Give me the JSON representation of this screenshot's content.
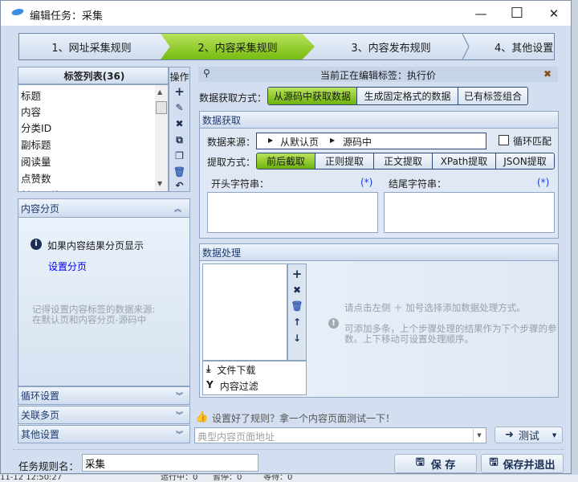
{
  "window": {
    "title": "编辑任务：采集",
    "minimize": "—",
    "maximize": "☐",
    "close": "✕"
  },
  "steps": [
    "1、网址采集规则",
    "2、内容采集规则",
    "3、内容发布规则",
    "4、其他设置"
  ],
  "active_step": 1,
  "tag_list": {
    "header": "标签列表(36)",
    "ops_label": "操作",
    "items": [
      "标题",
      "内容",
      "分类ID",
      "副标题",
      "阅读量",
      "点赞数",
      "封面图片"
    ]
  },
  "content_paging": {
    "title": "内容分页",
    "info": "如果内容结果分页显示",
    "link": "设置分页",
    "note1": "记得设置内容标签的数据来源:",
    "note2": "在默认页和内容分页-源码中"
  },
  "accordions": [
    "循环设置",
    "关联多页",
    "其他设置"
  ],
  "current_tag": "当前正在编辑标签：执行价",
  "fetch_mode": {
    "label": "数据获取方式：",
    "options": [
      "从源码中获取数据",
      "生成固定格式的数据",
      "已有标签组合"
    ],
    "selected": 0
  },
  "data_fetch": {
    "title": "数据获取",
    "source_label": "数据来源：",
    "source_parts": [
      "从默认页",
      "源码中"
    ],
    "loop_match": "循环匹配",
    "loop_checked": false,
    "extract_label": "提取方式：",
    "extract_options": [
      "前后截取",
      "正则提取",
      "正文提取",
      "XPath提取",
      "JSON提取"
    ],
    "extract_selected": 0,
    "start_label": "开头字符串：",
    "end_label": "结尾字符串：",
    "wildcard": "(*)",
    "start_value": "",
    "end_value": ""
  },
  "data_process": {
    "title": "数据处理",
    "items": [
      "文件下载",
      "内容过滤"
    ],
    "hint1": "请点击左侧 ＋ 加号选择添加数据处理方式。",
    "hint2": "可添加多条，上个步骤处理的结果作为下个步骤的参数。上下移动可设置处理顺序。"
  },
  "test": {
    "hint": "设置好了规则？拿一个内容页面测试一下！",
    "url_placeholder": "典型内容页面地址",
    "button": "测试"
  },
  "footer": {
    "name_label": "任务规则名：",
    "name_value": "采集",
    "save": "保 存",
    "save_exit": "保存并退出"
  },
  "statusbar": {
    "time": "11-12 12:50:27",
    "running": "运行中：0",
    "paused": "暂停：0",
    "waiting": "等待：0"
  }
}
